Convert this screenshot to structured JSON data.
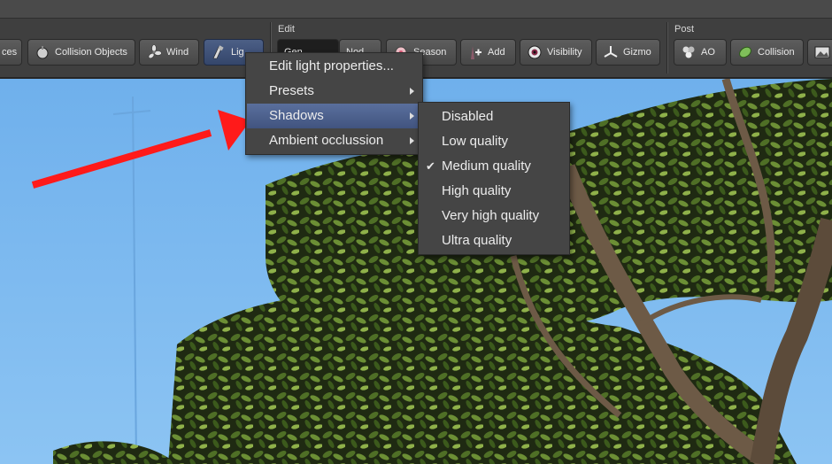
{
  "toolbar": {
    "groups": {
      "edit": "Edit",
      "post": "Post"
    },
    "buttons": {
      "forces_partial": "ces",
      "collision_objects": "Collision Objects",
      "wind": "Wind",
      "lights_partial": "Lig",
      "edit_dark_left": "Gen",
      "edit_dark_right": "Nod",
      "season": "Season",
      "add": "Add",
      "visibility": "Visibility",
      "gizmo": "Gizmo",
      "ao": "AO",
      "collision": "Collision"
    }
  },
  "light_menu": {
    "items": [
      {
        "label": "Edit light properties...",
        "submenu": false
      },
      {
        "label": "Presets",
        "submenu": true
      },
      {
        "label": "Shadows",
        "submenu": true,
        "highlighted": true
      },
      {
        "label": "Ambient occlussion",
        "submenu": true
      }
    ]
  },
  "shadows_submenu": {
    "items": [
      {
        "label": "Disabled",
        "checked": false
      },
      {
        "label": "Low quality",
        "checked": false
      },
      {
        "label": "Medium quality",
        "checked": true
      },
      {
        "label": "High quality",
        "checked": false
      },
      {
        "label": "Very high quality",
        "checked": false
      },
      {
        "label": "Ultra quality",
        "checked": false
      }
    ],
    "check_glyph": "✔"
  },
  "annotation": {
    "arrow_color": "#ff1a1a"
  },
  "colors": {
    "highlight": "#4b5f8c",
    "menu_bg": "#454545",
    "sky": "#7fb6ea"
  }
}
